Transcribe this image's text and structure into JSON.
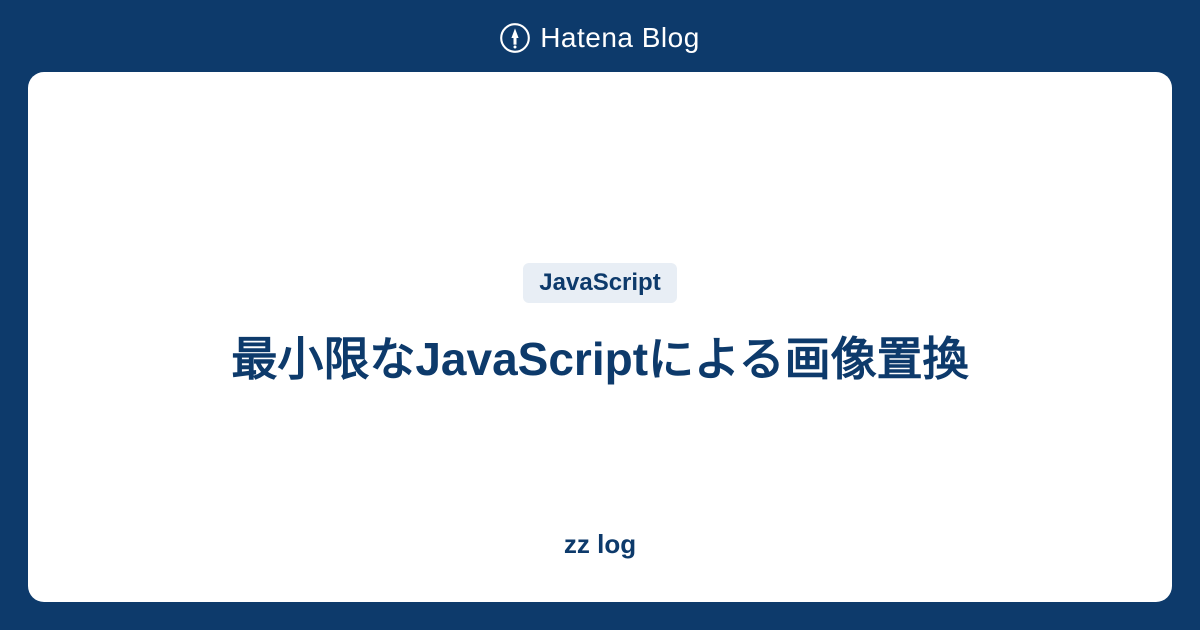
{
  "header": {
    "brand_text": "Hatena Blog"
  },
  "card": {
    "tag": "JavaScript",
    "title": "最小限なJavaScriptによる画像置換",
    "blog_name": "zz log"
  }
}
